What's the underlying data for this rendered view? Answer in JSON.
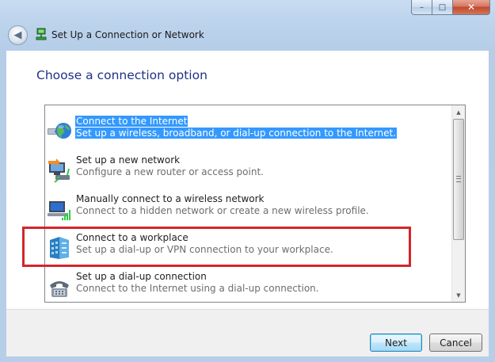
{
  "window": {
    "title": "Set Up a Connection or Network",
    "caption_buttons": {
      "minimize": "–",
      "maximize": "□",
      "close": "✕"
    },
    "back_glyph": "◀"
  },
  "heading": "Choose a connection option",
  "options": [
    {
      "title": "Connect to the Internet",
      "description": "Set up a wireless, broadband, or dial-up connection to the Internet.",
      "icon": "globe-network-icon",
      "selected": true
    },
    {
      "title": "Set up a new network",
      "description": "Configure a new router or access point.",
      "icon": "router-setup-icon",
      "selected": false
    },
    {
      "title": "Manually connect to a wireless network",
      "description": "Connect to a hidden network or create a new wireless profile.",
      "icon": "wireless-computer-icon",
      "selected": false
    },
    {
      "title": "Connect to a workplace",
      "description": "Set up a dial-up or VPN connection to your workplace.",
      "icon": "workplace-building-icon",
      "selected": false
    },
    {
      "title": "Set up a dial-up connection",
      "description": "Connect to the Internet using a dial-up connection.",
      "icon": "telephone-icon",
      "selected": false
    }
  ],
  "scrollbar": {
    "up_glyph": "▲",
    "down_glyph": "▼"
  },
  "buttons": {
    "next": "Next",
    "cancel": "Cancel"
  },
  "colors": {
    "selection": "#3399ff",
    "heading": "#1e3287",
    "highlight_border": "#d3262a"
  }
}
